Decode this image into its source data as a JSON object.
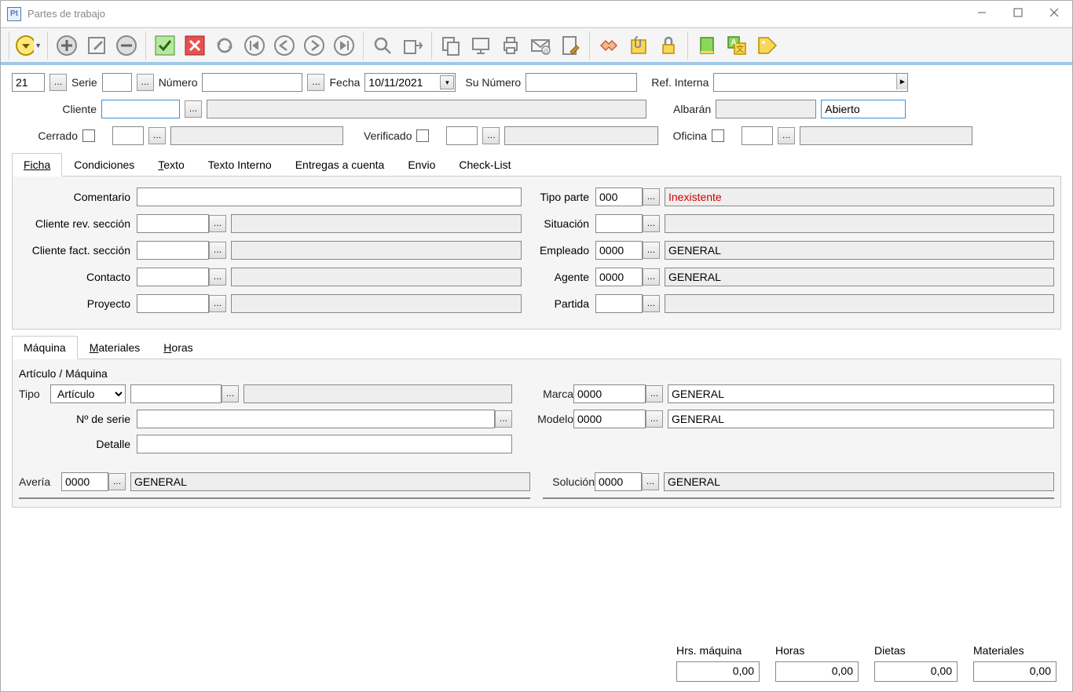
{
  "window": {
    "title": "Partes de trabajo",
    "app_icon_text": "Pt"
  },
  "header": {
    "code": "21",
    "serie_label": "Serie",
    "serie": "",
    "numero_label": "Número",
    "numero": "",
    "fecha_label": "Fecha",
    "fecha": "10/11/2021",
    "su_numero_label": "Su Número",
    "su_numero": "",
    "ref_interna_label": "Ref. Interna",
    "ref_interna": "",
    "cliente_label": "Cliente",
    "cliente_code": "",
    "cliente_name": "",
    "albaran_label": "Albarán",
    "albaran": "",
    "estado": "Abierto",
    "cerrado_label": "Cerrado",
    "cerrado_code": "",
    "cerrado_name": "",
    "verificado_label": "Verificado",
    "verificado_code": "",
    "verificado_name": "",
    "oficina_label": "Oficina",
    "oficina_code": "",
    "oficina_name": ""
  },
  "tabs": {
    "ficha": "Ficha",
    "condiciones": "Condiciones",
    "texto": "Texto",
    "texto_interno": "Texto Interno",
    "entregas": "Entregas a cuenta",
    "envio": "Envio",
    "checklist": "Check-List"
  },
  "ficha": {
    "comentario_label": "Comentario",
    "comentario": "",
    "cliente_rev_label": "Cliente rev. sección",
    "cliente_rev_code": "",
    "cliente_rev_name": "",
    "cliente_fact_label": "Cliente fact. sección",
    "cliente_fact_code": "",
    "cliente_fact_name": "",
    "contacto_label": "Contacto",
    "contacto_code": "",
    "contacto_name": "",
    "proyecto_label": "Proyecto",
    "proyecto_code": "",
    "proyecto_name": "",
    "tipo_parte_label": "Tipo parte",
    "tipo_parte_code": "000",
    "tipo_parte_name": "Inexistente",
    "situacion_label": "Situación",
    "situacion_code": "",
    "situacion_name": "",
    "empleado_label": "Empleado",
    "empleado_code": "0000",
    "empleado_name": "GENERAL",
    "agente_label": "Agente",
    "agente_code": "0000",
    "agente_name": "GENERAL",
    "partida_label": "Partida",
    "partida_code": "",
    "partida_name": ""
  },
  "subtabs": {
    "maquina": "Máquina",
    "materiales": "Materiales",
    "horas": "Horas"
  },
  "maquina": {
    "grupo_label": "Artículo / Máquina",
    "tipo_label": "Tipo",
    "tipo_value": "Artículo",
    "articulo_code": "",
    "articulo_name": "",
    "num_serie_label": "Nº de serie",
    "num_serie": "",
    "detalle_label": "Detalle",
    "detalle": "",
    "marca_label": "Marca",
    "marca_code": "0000",
    "marca_name": "GENERAL",
    "modelo_label": "Modelo",
    "modelo_code": "0000",
    "modelo_name": "GENERAL",
    "averia_label": "Avería",
    "averia_code": "0000",
    "averia_name": "GENERAL",
    "solucion_label": "Solución",
    "solucion_code": "0000",
    "solucion_name": "GENERAL"
  },
  "footer": {
    "hrs_maquina_label": "Hrs. máquina",
    "hrs_maquina": "0,00",
    "horas_label": "Horas",
    "horas": "0,00",
    "dietas_label": "Dietas",
    "dietas": "0,00",
    "materiales_label": "Materiales",
    "materiales": "0,00"
  }
}
